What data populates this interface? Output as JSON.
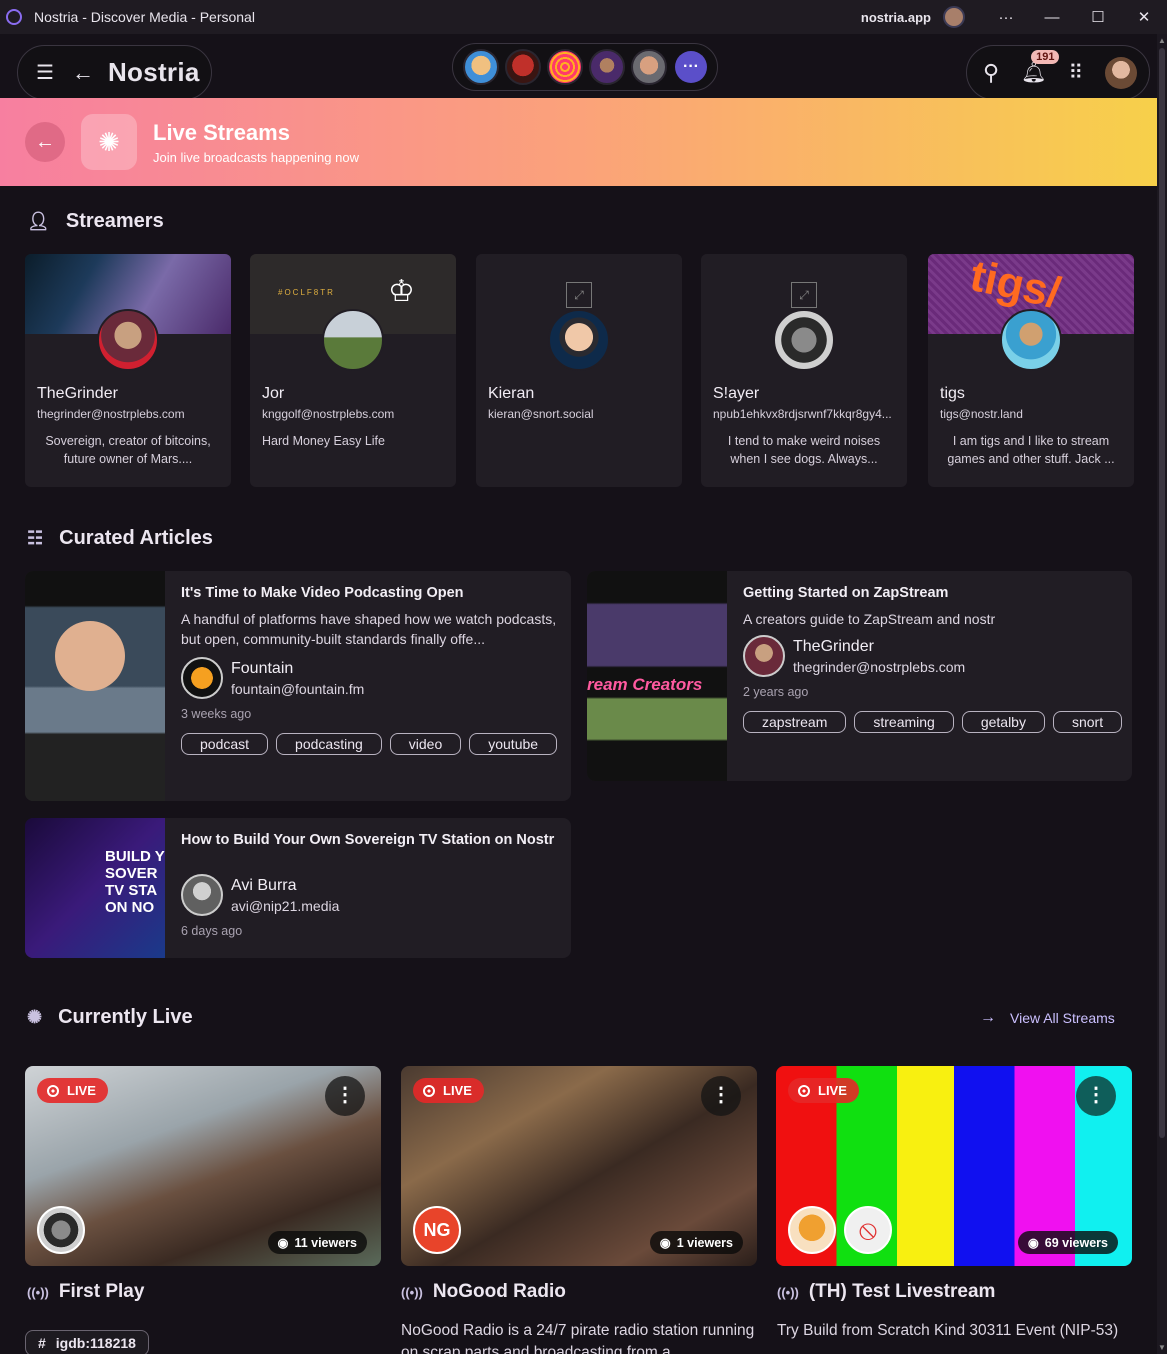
{
  "window": {
    "title": "Nostria - Discover Media - Personal",
    "domain": "nostria.app",
    "more": "···",
    "min": "—",
    "max": "☐",
    "close": "✕"
  },
  "header": {
    "brand": "Nostria",
    "notifications": "191"
  },
  "hero": {
    "title": "Live Streams",
    "subtitle": "Join live broadcasts happening now"
  },
  "streamers_section": {
    "title": "Streamers"
  },
  "streamers": [
    {
      "name": "TheGrinder",
      "nip05": "thegrinder@nostrplebs.com",
      "about": "Sovereign, creator of bitcoins, future owner of Mars...."
    },
    {
      "name": "Jor",
      "nip05": "knggolf@nostrplebs.com",
      "about": "Hard Money Easy Life"
    },
    {
      "name": "Kieran",
      "nip05": "kieran@snort.social",
      "about": ""
    },
    {
      "name": "S!ayer",
      "nip05": "npub1ehkvx8rdjsrwnf7kkqr8gy4...",
      "about": "I tend to make weird noises when I see dogs. Always..."
    },
    {
      "name": "tigs",
      "nip05": "tigs@nostr.land",
      "about": "I am tigs and I like to stream games and other stuff. Jack ..."
    }
  ],
  "articles_section": {
    "title": "Curated Articles"
  },
  "articles": [
    {
      "title": "It's Time to Make Video Podcasting Open",
      "description": "A handful of platforms have shaped how we watch podcasts, but open, community-built standards finally offe...",
      "author": "Fountain",
      "nip05": "fountain@fountain.fm",
      "date": "3 weeks ago",
      "tags": [
        "podcast",
        "podcasting",
        "video",
        "youtube"
      ]
    },
    {
      "title": "Getting Started on ZapStream",
      "description": "A creators guide to ZapStream and nostr",
      "author": "TheGrinder",
      "nip05": "thegrinder@nostrplebs.com",
      "date": "2 years ago",
      "tags": [
        "zapstream",
        "streaming",
        "getalby",
        "snort"
      ]
    },
    {
      "title": "How to Build Your Own Sovereign TV Station on Nostr",
      "author": "Avi Burra",
      "nip05": "avi@nip21.media",
      "date": "6 days ago"
    }
  ],
  "live_section": {
    "title": "Currently Live",
    "view_all": "View All Streams"
  },
  "live_streams": [
    {
      "badge": "LIVE",
      "viewers": "11 viewers",
      "title": "First Play",
      "hashtag": "igdb:118218",
      "description": ""
    },
    {
      "badge": "LIVE",
      "viewers": "1 viewers",
      "title": "NoGood Radio",
      "description": "NoGood Radio is a 24/7 pirate radio station running on scrap parts and broadcasting from a"
    },
    {
      "badge": "LIVE",
      "viewers": "69 viewers",
      "title": "(TH) Test Livestream",
      "description": "Try Build from Scratch Kind 30311 Event (NIP-53)"
    }
  ],
  "thumb_texts": {
    "zap_thumb": "ream Creators",
    "tv_thumb": "BUILD Y SOVER TV STA ON NO",
    "ng_logo": "NG",
    "banner_jor": "#OCLF8TR"
  }
}
